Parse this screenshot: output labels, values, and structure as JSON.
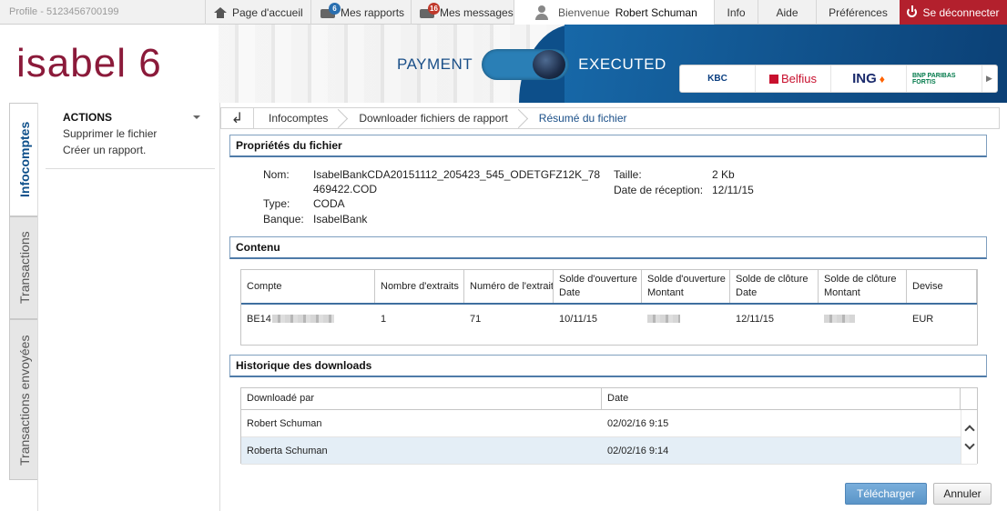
{
  "topbar": {
    "profile": "Profile - 5123456700199",
    "home": "Page d'accueil",
    "reports": "Mes rapports",
    "reports_badge": "6",
    "messages": "Mes messages",
    "messages_badge": "16",
    "welcome_label": "Bienvenue",
    "user_name": "Robert Schuman",
    "info": "Info",
    "help": "Aide",
    "preferences": "Préférences",
    "logout": "Se déconnecter"
  },
  "header": {
    "logo": "isabel 6",
    "toggle_left": "PAYMENT",
    "toggle_right": "EXECUTED",
    "banks": [
      "KBC",
      "Belfius",
      "ING",
      "BNP PARIBAS FORTIS"
    ]
  },
  "vtabs": [
    "Infocomptes",
    "Transactions",
    "Transactions envoyées"
  ],
  "actions": {
    "title": "ACTIONS",
    "items": [
      "Supprimer le fichier",
      "Créer un rapport."
    ]
  },
  "breadcrumb": [
    "Infocomptes",
    "Downloader fichiers de rapport",
    "Résumé du fichier"
  ],
  "properties": {
    "title": "Propriétés du fichier",
    "name_label": "Nom:",
    "name_line1": "IsabelBankCDA20151112_205423_545_ODETGFZ12K_78",
    "name_line2": "469422.COD",
    "type_label": "Type:",
    "type_value": "CODA",
    "bank_label": "Banque:",
    "bank_value": "IsabelBank",
    "size_label": "Taille:",
    "size_value": "2 Kb",
    "received_label": "Date de réception:",
    "received_value": "12/11/15"
  },
  "content": {
    "title": "Contenu",
    "columns": [
      [
        "Compte",
        ""
      ],
      [
        "Nombre d'extraits",
        ""
      ],
      [
        "Numéro de l'extrait",
        ""
      ],
      [
        "Solde d'ouverture",
        "Date"
      ],
      [
        "Solde d'ouverture",
        "Montant"
      ],
      [
        "Solde de clôture",
        "Date"
      ],
      [
        "Solde de clôture",
        "Montant"
      ],
      [
        "Devise",
        ""
      ]
    ],
    "row": {
      "account": "BE14",
      "extracts": "1",
      "number": "71",
      "open_date": "10/11/15",
      "close_date": "12/11/15",
      "currency": "EUR"
    }
  },
  "history": {
    "title": "Historique des downloads",
    "col_by": "Downloadé par",
    "col_date": "Date",
    "rows": [
      {
        "by": "Robert Schuman",
        "date": "02/02/16 9:15"
      },
      {
        "by": "Roberta Schuman",
        "date": "02/02/16 9:14"
      }
    ]
  },
  "buttons": {
    "download": "Télécharger",
    "cancel": "Annuler"
  },
  "colors": {
    "logout_bg": "#b3202d",
    "brand": "#8b1a3a",
    "accent": "#0d4f8a"
  }
}
